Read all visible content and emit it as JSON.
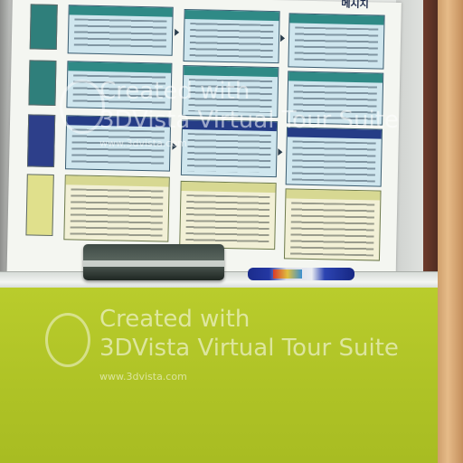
{
  "poster": {
    "corner_label": "메시지"
  },
  "watermark": {
    "line1": "Created with",
    "line2": "3DVista Virtual Tour Suite",
    "url": "www.3dvista.com"
  },
  "icons": [
    "3dvista-logo-icon"
  ]
}
